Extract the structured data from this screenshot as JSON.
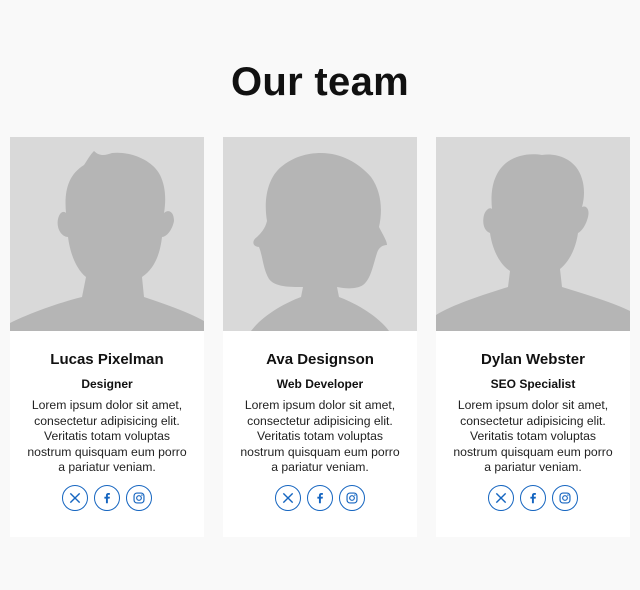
{
  "page": {
    "title": "Our team"
  },
  "members": [
    {
      "name": "Lucas Pixelman",
      "role": "Designer",
      "bio": "Lorem ipsum dolor sit amet, consectetur adipisicing elit. Veritatis totam voluptas nostrum quisquam eum porro a pariatur veniam.",
      "avatar": "male-short-hair-silhouette"
    },
    {
      "name": "Ava Designson",
      "role": "Web Developer",
      "bio": "Lorem ipsum dolor sit amet, consectetur adipisicing elit. Veritatis totam voluptas nostrum quisquam eum porro a pariatur veniam.",
      "avatar": "female-bob-hair-silhouette"
    },
    {
      "name": "Dylan Webster",
      "role": "SEO Specialist",
      "bio": "Lorem ipsum dolor sit amet, consectetur adipisicing elit. Veritatis totam voluptas nostrum quisquam eum porro a pariatur veniam.",
      "avatar": "male-silhouette"
    }
  ],
  "social_icons": [
    "x-icon",
    "facebook-icon",
    "instagram-icon"
  ],
  "colors": {
    "background": "#f9f9f9",
    "card": "#ffffff",
    "photo_bg": "#d9d9d9",
    "silhouette": "#b5b5b5",
    "accent": "#1565c0"
  }
}
